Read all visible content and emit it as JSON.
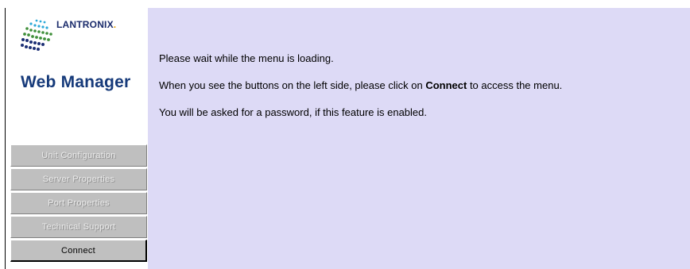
{
  "brand": {
    "logo_text": "LANTRONIX",
    "logo_dot": ".",
    "app_title": "Web Manager"
  },
  "menu": {
    "items": [
      {
        "label": "Unit Configuration",
        "enabled": false
      },
      {
        "label": "Server Properties",
        "enabled": false
      },
      {
        "label": "Port Properties",
        "enabled": false
      },
      {
        "label": "Technical Support",
        "enabled": false
      },
      {
        "label": "Connect",
        "enabled": true
      }
    ]
  },
  "content": {
    "line1": "Please wait while the menu is loading.",
    "line2_before": "When you see the buttons on the left side, please click on ",
    "line2_bold": "Connect",
    "line2_after": " to access the menu.",
    "line3": "You will be asked for a password, if this feature is enabled."
  },
  "colors": {
    "content_background": "#dddaf6",
    "title_color": "#163a7a",
    "disabled_button": "#bfbfbf"
  }
}
